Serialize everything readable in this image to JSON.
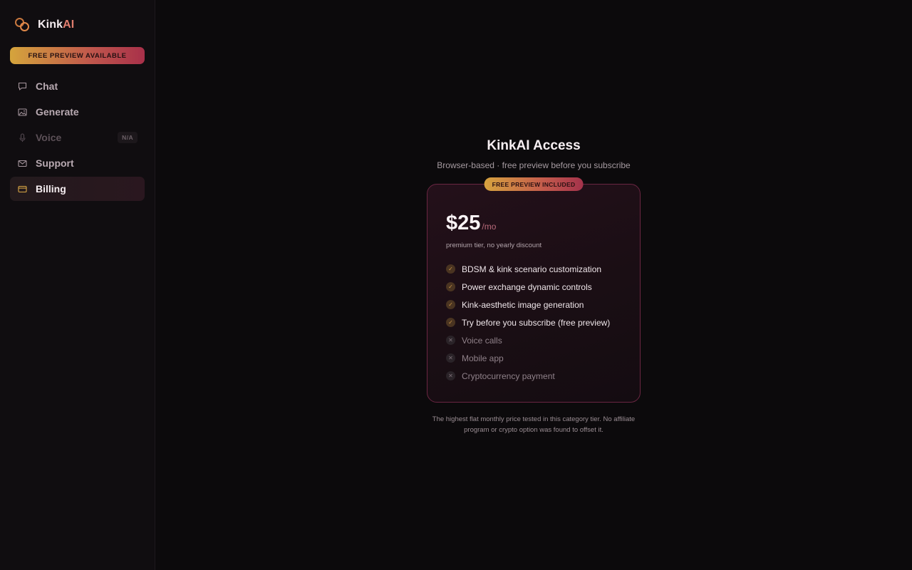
{
  "brand": {
    "name_main": "Kink",
    "name_accent": "AI"
  },
  "sidebar": {
    "preview_pill": "FREE PREVIEW AVAILABLE",
    "items": [
      {
        "label": "Chat",
        "icon": "chat-bubble-icon",
        "state": "normal"
      },
      {
        "label": "Generate",
        "icon": "image-icon",
        "state": "normal"
      },
      {
        "label": "Voice",
        "icon": "microphone-icon",
        "state": "disabled",
        "badge": "N/A"
      },
      {
        "label": "Support",
        "icon": "mail-icon",
        "state": "normal"
      },
      {
        "label": "Billing",
        "icon": "credit-card-icon",
        "state": "active"
      }
    ]
  },
  "main": {
    "title": "KinkAI Access",
    "subtitle": "Browser-based · free preview before you subscribe",
    "card": {
      "badge": "FREE PREVIEW INCLUDED",
      "price": "$25",
      "period": "/mo",
      "price_note": "premium tier, no yearly discount",
      "features": [
        {
          "text": "BDSM & kink scenario customization",
          "included": true
        },
        {
          "text": "Power exchange dynamic controls",
          "included": true
        },
        {
          "text": "Kink-aesthetic image generation",
          "included": true
        },
        {
          "text": "Try before you subscribe (free preview)",
          "included": true
        },
        {
          "text": "Voice calls",
          "included": false
        },
        {
          "text": "Mobile app",
          "included": false
        },
        {
          "text": "Cryptocurrency payment",
          "included": false
        }
      ]
    },
    "footnote": "The highest flat monthly price tested in this category tier. No affiliate program or crypto option was found to offset it."
  },
  "colors": {
    "background": "#0c0a0c",
    "accent_gold": "#d5a43c",
    "accent_rose": "#a8304a",
    "card_border": "#6a2642"
  }
}
